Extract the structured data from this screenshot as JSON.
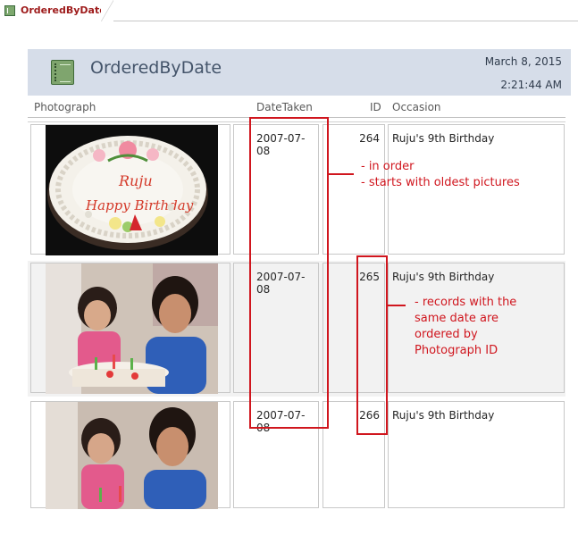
{
  "tab": {
    "label": "OrderedByDate",
    "icon": "report-icon"
  },
  "header": {
    "title": "OrderedByDate",
    "date": "March 8, 2015",
    "time": "2:21:44 AM"
  },
  "columns": [
    "Photograph",
    "DateTaken",
    "ID",
    "Occasion"
  ],
  "rows": [
    {
      "date": "2007-07-08",
      "id": "264",
      "occasion": "Ruju's 9th Birthday",
      "photo": "birthday cake"
    },
    {
      "date": "2007-07-08",
      "id": "265",
      "occasion": "Ruju's 9th Birthday",
      "photo": "girls blowing candles"
    },
    {
      "date": "2007-07-08",
      "id": "266",
      "occasion": "Ruju's 9th Birthday",
      "photo": "girls blowing candles"
    }
  ],
  "annotations": {
    "date_note": [
      "- in order",
      "- starts with oldest pictures"
    ],
    "id_note": [
      "- records with the",
      "same date are",
      "ordered by",
      "Photograph ID"
    ]
  },
  "colors": {
    "annotation": "#d0161e",
    "header_band": "#d6dde9",
    "title": "#44546a"
  }
}
